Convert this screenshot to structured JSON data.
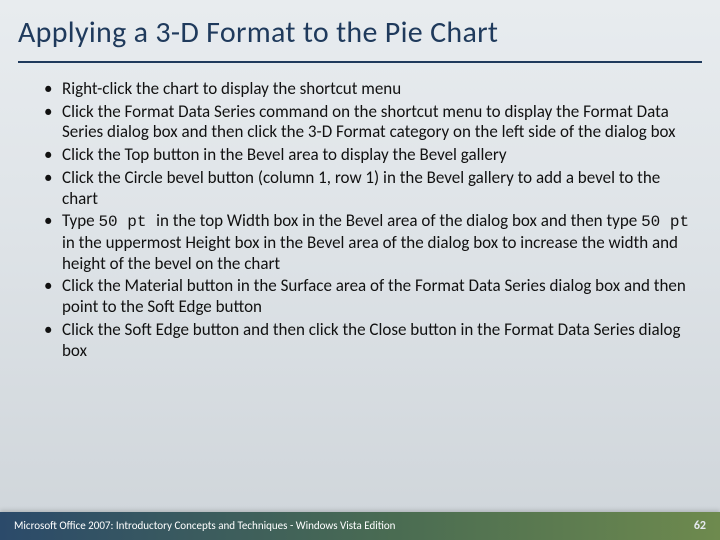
{
  "title": "Applying a 3-D Format to the Pie Chart",
  "bullets": [
    {
      "pre": "Right-click the chart to display the shortcut menu"
    },
    {
      "pre": "Click the Format Data Series command on the shortcut menu to display the Format Data Series dialog box and then click the 3-D Format category on the left side of the dialog box"
    },
    {
      "pre": "Click the Top button in the Bevel area to display the Bevel gallery"
    },
    {
      "pre": "Click the Circle bevel button (column 1, row 1) in the Bevel gallery to add a bevel to the chart"
    },
    {
      "pre": "Type ",
      "code1": "50 pt ",
      "mid": " in the top Width box in the Bevel area of the dialog box and then type ",
      "code2": "50 pt ",
      "post": " in the uppermost Height box in the Bevel area of the dialog box to increase the width and height of the bevel on the chart"
    },
    {
      "pre": "Click the Material button in the Surface area of the Format Data Series dialog box and then point to the Soft Edge button"
    },
    {
      "pre": "Click the Soft Edge button and then click the Close button in the Format Data Series dialog box"
    }
  ],
  "footer": {
    "left": "Microsoft Office 2007: Introductory Concepts and Techniques - Windows Vista Edition",
    "page": "62"
  }
}
